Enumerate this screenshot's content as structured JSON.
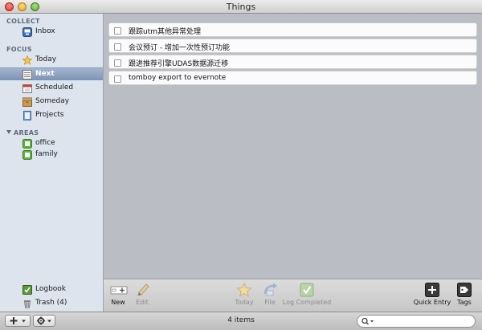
{
  "window": {
    "title": "Things"
  },
  "sidebar": {
    "collect_header": "COLLECT",
    "focus_header": "FOCUS",
    "areas_header": "AREAS",
    "collect": [
      {
        "label": "Inbox",
        "icon": "inbox-icon"
      }
    ],
    "focus": [
      {
        "label": "Today",
        "icon": "star-icon"
      },
      {
        "label": "Next",
        "icon": "next-icon",
        "selected": true
      },
      {
        "label": "Scheduled",
        "icon": "calendar-icon"
      },
      {
        "label": "Someday",
        "icon": "box-icon"
      },
      {
        "label": "Projects",
        "icon": "projects-icon"
      }
    ],
    "areas": [
      {
        "label": "office",
        "icon": "area-icon"
      },
      {
        "label": "family",
        "icon": "area-icon"
      }
    ],
    "bottom": [
      {
        "label": "Logbook",
        "icon": "logbook-icon"
      },
      {
        "label": "Trash (4)",
        "icon": "trash-icon"
      }
    ]
  },
  "tasks": [
    {
      "title": "跟踪utm其他异常处理",
      "done": false
    },
    {
      "title": "会议预订 - 增加一次性预订功能",
      "done": false
    },
    {
      "title": "跟进推荐引擎UDAS数据源迁移",
      "done": false
    },
    {
      "title": "tomboy export to evernote",
      "done": false
    }
  ],
  "toolbar": {
    "new": "New",
    "edit": "Edit",
    "today": "Today",
    "file": "File",
    "log_completed": "Log Completed",
    "quick_entry": "Quick Entry",
    "tags": "Tags"
  },
  "status": {
    "items": "4 items"
  },
  "colors": {
    "selection": "#7d93b6",
    "area_green": "#5fb33a"
  }
}
